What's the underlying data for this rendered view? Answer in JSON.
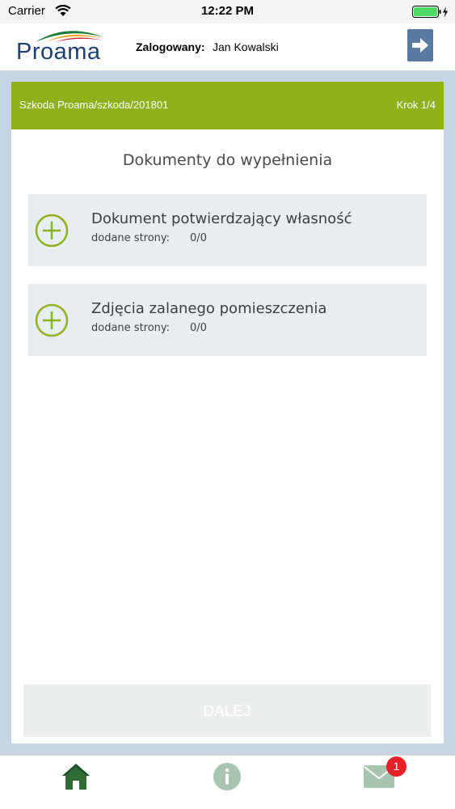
{
  "status_bar": {
    "carrier": "Carrier",
    "time": "12:22 PM"
  },
  "header": {
    "logo_text": "Proama",
    "logged_label": "Zalogowany:",
    "user_name": "Jan Kowalski",
    "logout_icon": "logout-arrow-icon"
  },
  "claim": {
    "path": "Szkoda Proama/szkoda/201801",
    "step": "Krok 1/4"
  },
  "section_title": "Dokumenty do wypełnienia",
  "documents": [
    {
      "title": "Dokument potwierdzający własność",
      "pages_label": "dodane strony:",
      "pages_value": "0/0"
    },
    {
      "title": "Zdjęcia zalanego pomieszczenia",
      "pages_label": "dodane strony:",
      "pages_value": "0/0"
    }
  ],
  "next_button": "DALEJ",
  "tab_bar": {
    "home_icon": "home-icon",
    "info_icon": "info-icon",
    "mail_icon": "mail-icon",
    "mail_badge": "1"
  },
  "colors": {
    "accent_green": "#8db21c",
    "frame_blue": "#c6d5e4",
    "logo_blue": "#1c3f74",
    "logout_blue": "#587a9f",
    "badge_red": "#e8202a"
  }
}
